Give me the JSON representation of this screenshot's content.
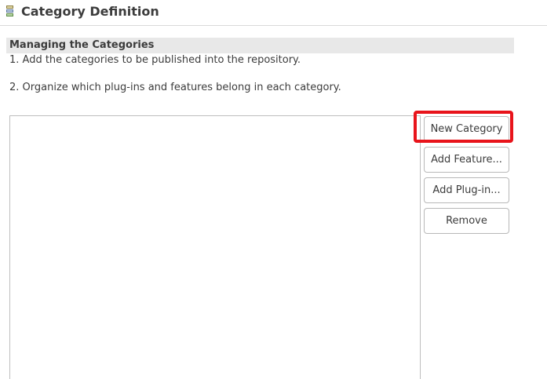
{
  "header": {
    "title": "Category Definition",
    "icon": "category-definition-icon"
  },
  "section": {
    "title": "Managing the Categories",
    "steps": [
      "1. Add the categories to be published into the repository.",
      "2. Organize which plug-ins and features belong in each category."
    ]
  },
  "buttons": {
    "new_category": "New Category",
    "add_feature": "Add Feature...",
    "add_plugin": "Add Plug-in...",
    "remove": "Remove"
  },
  "colors": {
    "highlight": "#e8141b",
    "section_bar": "#e8e8e8"
  }
}
